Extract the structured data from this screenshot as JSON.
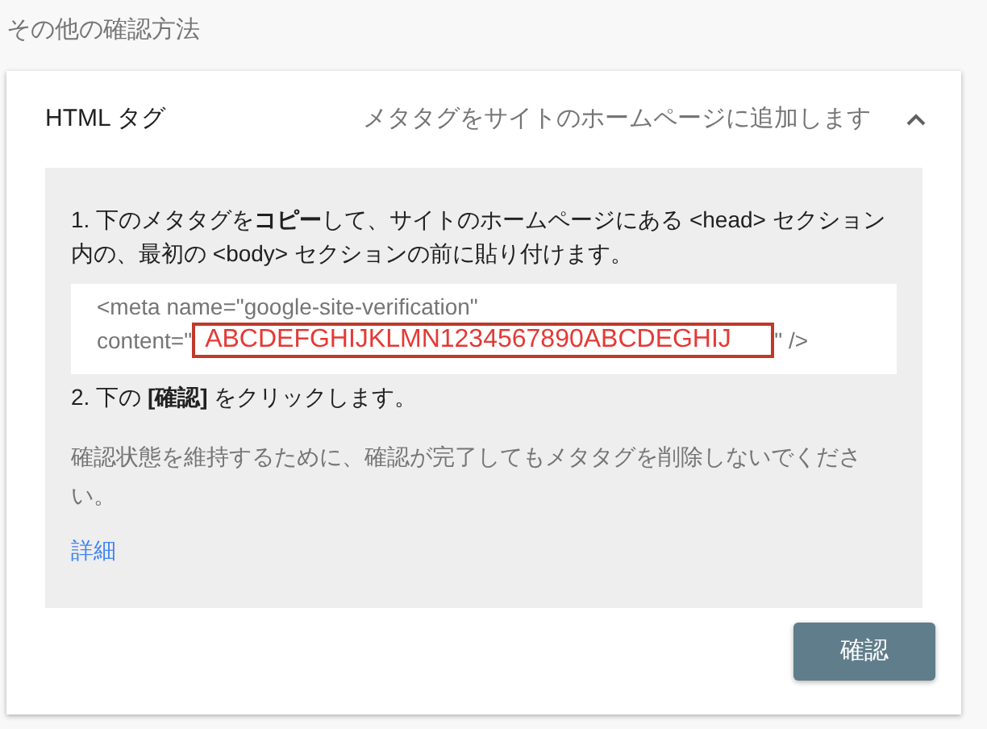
{
  "section_title": "その他の確認方法",
  "method": {
    "title": "HTML タグ",
    "description": "メタタグをサイトのホームページに追加します",
    "expanded": true,
    "steps": [
      "1. 下のメタタグを**コピー**して、サイトのホームページにある <head> セクション内の、最初の <body> セクションの前に貼り付けます。"
    ],
    "code": {
      "line_1": "<meta name=\"google-site-verification\"",
      "prefix": "content=\"",
      "token": "ABCDEFGHIJKLMN1234567890ABCDEGHIJ",
      "suffix": "\" />"
    },
    "step_2": "2. 下の **[確認]** をクリックします。",
    "note": "確認状態を維持するために、確認が完了してもメタタグを削除しないでください。",
    "link": "詳細",
    "button": "確認"
  }
}
